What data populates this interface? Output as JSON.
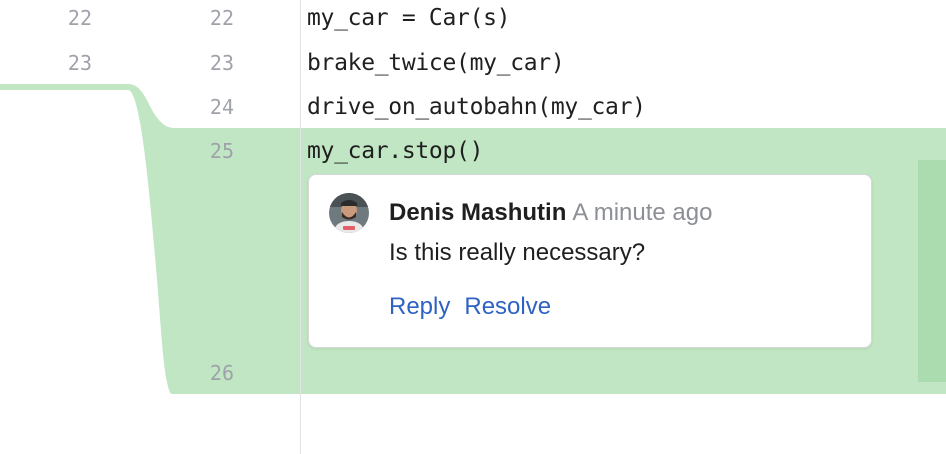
{
  "diff": {
    "left_line_numbers": [
      "22",
      "23"
    ],
    "right_line_numbers": [
      "22",
      "23",
      "24",
      "25",
      "26"
    ],
    "code_lines": [
      "my_car = Car(s)",
      "brake_twice(my_car)",
      "drive_on_autobahn(my_car)",
      "my_car.stop()"
    ],
    "colors": {
      "added_background": "#c1e6c3",
      "added_marker": "#aadcaf",
      "line_number": "#9fa2aa"
    }
  },
  "comment": {
    "author": "Denis Mashutin",
    "timestamp": "A minute ago",
    "text": "Is this really necessary?",
    "actions": {
      "reply": "Reply",
      "resolve": "Resolve"
    },
    "link_color": "#2f63c2",
    "avatar_icon": "user-avatar"
  }
}
